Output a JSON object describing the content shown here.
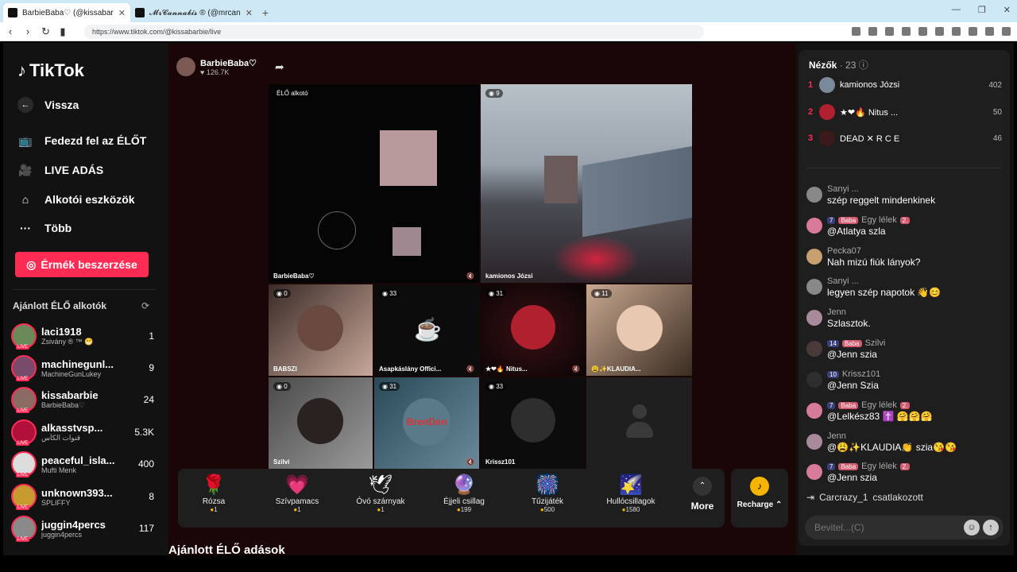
{
  "browser": {
    "tabs": [
      {
        "title": "BarbieBaba♡ (@kissabarbie)"
      },
      {
        "title": "𝓜𝓻𝓒𝓪𝓷𝓷𝓪𝓫𝓲𝓼 ® (@mrcannabis)"
      }
    ],
    "url": "https://www.tiktok.com/@kissabarbie/live"
  },
  "sidebar": {
    "logo": "TikTok",
    "back": "Vissza",
    "nav": [
      {
        "label": "Fedezd fel az ÉLŐT",
        "icon": "tv-icon"
      },
      {
        "label": "LIVE ADÁS",
        "icon": "camera-icon"
      },
      {
        "label": "Alkotói eszközök",
        "icon": "tools-icon"
      },
      {
        "label": "Több",
        "icon": "more-icon"
      }
    ],
    "coins_button": "Érmék beszerzése",
    "recommended_title": "Ajánlott ÉLŐ alkotók",
    "creators": [
      {
        "name": "laci1918",
        "sub": "Zsivány ® ™ 😁",
        "count": "1"
      },
      {
        "name": "machinegunl...",
        "sub": "MachineGunLukey",
        "count": "9"
      },
      {
        "name": "kissabarbie",
        "sub": "BarbieBaba♡",
        "count": "24"
      },
      {
        "name": "alkasstvsp...",
        "sub": "قنوات الكأس",
        "count": "5.3K"
      },
      {
        "name": "peaceful_isla...",
        "sub": "Mufti Menk",
        "count": "400"
      },
      {
        "name": "unknown393...",
        "sub": "SPLIFFY",
        "count": "8"
      },
      {
        "name": "juggin4percs",
        "sub": "juggin4percs",
        "count": "117"
      }
    ]
  },
  "live": {
    "host_name": "BarbieBaba♡",
    "host_likes": "126.7K",
    "main_label": "ÉLŐ alkotó",
    "host_tag": "BarbieBaba♡",
    "guest_main": {
      "count": "9",
      "name": "kamionos Józsi"
    },
    "guests": [
      {
        "count": "0",
        "name": "BABSZI"
      },
      {
        "count": "33",
        "name": "Asapkáslány Offici..."
      },
      {
        "count": "31",
        "name": "★❤🔥 Nitus..."
      },
      {
        "count": "11",
        "name": "😩✨KLAUDIA..."
      },
      {
        "count": "0",
        "name": "Szilvi"
      },
      {
        "count": "31",
        "name": "BrenDon"
      },
      {
        "count": "33",
        "name": "Krissz101"
      }
    ]
  },
  "gifts": [
    {
      "name": "Rózsa",
      "price": "1",
      "icon": "🌹"
    },
    {
      "name": "Szívpamacs",
      "price": "1",
      "icon": "💗"
    },
    {
      "name": "Óvó szárnyak",
      "price": "1",
      "icon": "🪽"
    },
    {
      "name": "Éjjeli csillag",
      "price": "199",
      "icon": "🔮"
    },
    {
      "name": "Tűzijáték",
      "price": "500",
      "icon": "🎆"
    },
    {
      "name": "Hullócsillagok",
      "price": "1580",
      "icon": "🌠"
    }
  ],
  "more_label": "More",
  "recharge_label": "Recharge",
  "recommended_lives_title": "Ajánlott ÉLŐ adások",
  "panel": {
    "title": "Nézők",
    "count": "23",
    "viewers": [
      {
        "rank": "1",
        "name": "kamionos Józsi",
        "score": "402"
      },
      {
        "rank": "2",
        "name": "★❤🔥 Nitus ...",
        "score": "50"
      },
      {
        "rank": "3",
        "name": "DEAD ✕ R C E",
        "score": "46"
      }
    ],
    "messages": [
      {
        "user": "Sanyi ...",
        "text": "szép reggelt mindenkinek"
      },
      {
        "user": "Egy lélek",
        "badges": [
          "7",
          "Baba",
          "2."
        ],
        "text": "@Atlatya szla"
      },
      {
        "user": "Pecka07",
        "text": "Nah mizú fiúk lányok?"
      },
      {
        "user": "Sanyi ...",
        "text": "legyen szép napotok 👋😊"
      },
      {
        "user": "Jenn",
        "text": "Szlasztok."
      },
      {
        "user": "Szilvi",
        "badges": [
          "14",
          "Baba"
        ],
        "text": "@Jenn szia"
      },
      {
        "user": "Krissz101",
        "badges": [
          "10"
        ],
        "text": "@Jenn Szia"
      },
      {
        "user": "Egy lélek",
        "badges": [
          "7",
          "Baba",
          "2."
        ],
        "text": "@Lelkész83 ✝️ 🤗🤗🤗"
      },
      {
        "user": "Jenn",
        "text": "@😩✨KLAUDIA👏 szia😘😘"
      },
      {
        "user": "Egy lélek",
        "badges": [
          "7",
          "Baba",
          "2."
        ],
        "text": "@Jenn szia"
      }
    ],
    "joined_user": "Carcrazy_1",
    "joined_text": "csatlakozott",
    "input_placeholder": "Bevitel...(C)"
  }
}
